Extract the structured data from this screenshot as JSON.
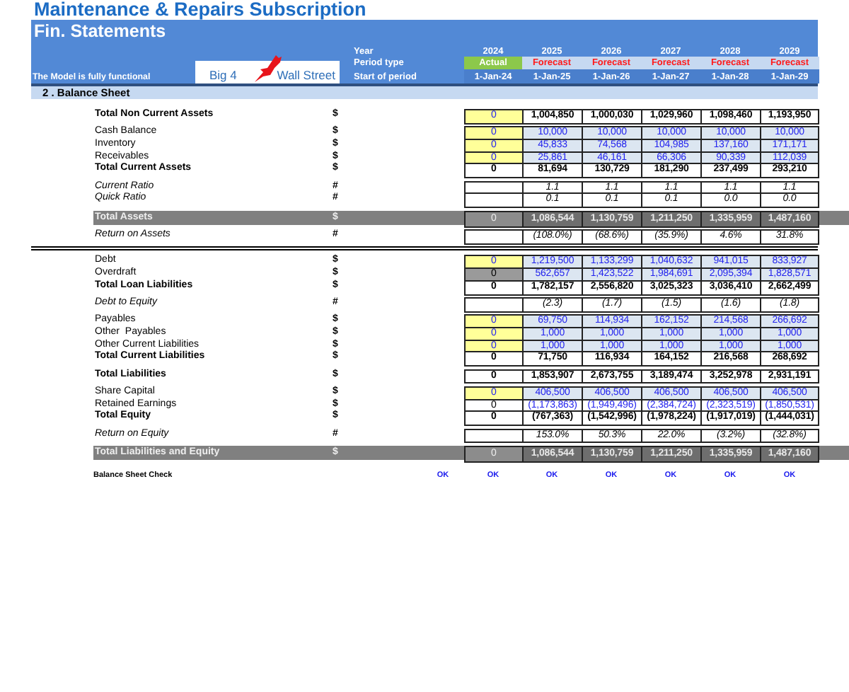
{
  "title": "Maintenance & Repairs Subscription",
  "sheet": "Fin. Statements",
  "model_status": "The Model is fully functional",
  "logo": {
    "left": "Big 4",
    "right": "Wall Street"
  },
  "header_labels": [
    "Year",
    "Period type",
    "Start of period"
  ],
  "periods": [
    {
      "year": "2024",
      "type": "Actual",
      "start": "1-Jan-24",
      "kind": "actual"
    },
    {
      "year": "2025",
      "type": "Forecast",
      "start": "1-Jan-25",
      "kind": "forecast"
    },
    {
      "year": "2026",
      "type": "Forecast",
      "start": "1-Jan-26",
      "kind": "forecast"
    },
    {
      "year": "2027",
      "type": "Forecast",
      "start": "1-Jan-27",
      "kind": "forecast"
    },
    {
      "year": "2028",
      "type": "Forecast",
      "start": "1-Jan-28",
      "kind": "forecast"
    },
    {
      "year": "2029",
      "type": "Forecast",
      "start": "1-Jan-29",
      "kind": "forecast"
    }
  ],
  "section": "2 . Balance Sheet",
  "blocks": [
    {
      "kind": "plain",
      "rows": [
        {
          "label": "Total Non Current Assets",
          "unit": "$",
          "kind": "total",
          "actual": {
            "value": "0",
            "kind": "input"
          },
          "values": [
            "1,004,850",
            "1,000,030",
            "1,029,960",
            "1,098,460",
            "1,193,950"
          ]
        }
      ]
    },
    {
      "kind": "plain",
      "rows": [
        {
          "label": "Cash Balance",
          "unit": "$",
          "kind": "input",
          "actual": {
            "value": "0",
            "kind": "input"
          },
          "values": [
            "10,000",
            "10,000",
            "10,000",
            "10,000",
            "10,000"
          ]
        },
        {
          "label": "Inventory",
          "unit": "$",
          "kind": "input",
          "actual": {
            "value": "0",
            "kind": "input"
          },
          "values": [
            "45,833",
            "74,568",
            "104,985",
            "137,160",
            "171,171"
          ]
        },
        {
          "label": "Receivables",
          "unit": "$",
          "kind": "input",
          "actual": {
            "value": "0",
            "kind": "input"
          },
          "values": [
            "25,861",
            "46,161",
            "66,306",
            "90,339",
            "112,039"
          ]
        },
        {
          "label": "Total Current Assets",
          "unit": "$",
          "kind": "total",
          "actual": {
            "value": "0",
            "kind": "calc"
          },
          "values": [
            "81,694",
            "130,729",
            "181,290",
            "237,499",
            "293,210"
          ]
        }
      ]
    },
    {
      "kind": "plain",
      "rows": [
        {
          "label": "Current Ratio",
          "unit": "#",
          "kind": "ratio",
          "values": [
            "1.1",
            "1.1",
            "1.1",
            "1.1",
            "1.1"
          ]
        },
        {
          "label": "Quick Ratio",
          "unit": "#",
          "kind": "ratio",
          "values": [
            "0.1",
            "0.1",
            "0.1",
            "0.0",
            "0.0"
          ]
        }
      ]
    },
    {
      "kind": "plain",
      "rows": [
        {
          "label": "Total Assets",
          "unit": "$",
          "kind": "band",
          "actual": {
            "value": "0",
            "kind": "band"
          },
          "values": [
            "1,086,544",
            "1,130,759",
            "1,211,250",
            "1,335,959",
            "1,487,160"
          ]
        }
      ]
    },
    {
      "kind": "plain",
      "rows": [
        {
          "label": "Return on Assets",
          "unit": "#",
          "kind": "ratio",
          "values": [
            "(108.0%)",
            "(68.6%)",
            "(35.9%)",
            "4.6%",
            "31.8%"
          ]
        }
      ]
    },
    {
      "kind": "ruled",
      "rows": [
        {
          "label": "Debt",
          "unit": "$",
          "kind": "input",
          "actual": {
            "value": "0",
            "kind": "input"
          },
          "values": [
            "1,219,500",
            "1,133,299",
            "1,040,632",
            "941,015",
            "833,927"
          ]
        },
        {
          "label": "Overdraft",
          "unit": "$",
          "kind": "input",
          "actual": {
            "value": "0",
            "kind": "grey"
          },
          "values": [
            "562,657",
            "1,423,522",
            "1,984,691",
            "2,095,394",
            "1,828,571"
          ]
        },
        {
          "label": "Total Loan Liabilities",
          "unit": "$",
          "kind": "total",
          "actual": {
            "value": "0",
            "kind": "calc"
          },
          "values": [
            "1,782,157",
            "2,556,820",
            "3,025,323",
            "3,036,410",
            "2,662,499"
          ]
        }
      ]
    },
    {
      "kind": "plain",
      "rows": [
        {
          "label": "Debt to Equity",
          "unit": "#",
          "kind": "ratio",
          "values": [
            "(2.3)",
            "(1.7)",
            "(1.5)",
            "(1.6)",
            "(1.8)"
          ]
        }
      ]
    },
    {
      "kind": "plain",
      "rows": [
        {
          "label": "Payables",
          "unit": "$",
          "kind": "input",
          "actual": {
            "value": "0",
            "kind": "input"
          },
          "values": [
            "69,750",
            "114,934",
            "162,152",
            "214,568",
            "266,692"
          ]
        },
        {
          "label": "Other  Payables",
          "unit": "$",
          "kind": "input",
          "actual": {
            "value": "0",
            "kind": "input"
          },
          "values": [
            "1,000",
            "1,000",
            "1,000",
            "1,000",
            "1,000"
          ]
        },
        {
          "label": "Other Current Liabilities",
          "unit": "$",
          "kind": "input",
          "actual": {
            "value": "0",
            "kind": "input"
          },
          "values": [
            "1,000",
            "1,000",
            "1,000",
            "1,000",
            "1,000"
          ]
        },
        {
          "label": "Total Current Liabilities",
          "unit": "$",
          "kind": "total",
          "actual": {
            "value": "0",
            "kind": "calc"
          },
          "values": [
            "71,750",
            "116,934",
            "164,152",
            "216,568",
            "268,692"
          ]
        }
      ]
    },
    {
      "kind": "plain",
      "rows": [
        {
          "label": "Total Liabilities",
          "unit": "$",
          "kind": "total",
          "actual": {
            "value": "0",
            "kind": "calc"
          },
          "values": [
            "1,853,907",
            "2,673,755",
            "3,189,474",
            "3,252,978",
            "2,931,191"
          ]
        }
      ]
    },
    {
      "kind": "plain",
      "rows": [
        {
          "label": "Share Capital",
          "unit": "$",
          "kind": "input",
          "actual": {
            "value": "0",
            "kind": "input"
          },
          "values": [
            "406,500",
            "406,500",
            "406,500",
            "406,500",
            "406,500"
          ]
        },
        {
          "label": "Retained Earnings",
          "unit": "$",
          "kind": "linked",
          "actual": {
            "value": "0",
            "kind": "calc"
          },
          "values": [
            "(1,173,863)",
            "(1,949,496)",
            "(2,384,724)",
            "(2,323,519)",
            "(1,850,531)"
          ]
        },
        {
          "label": "Total Equity",
          "unit": "$",
          "kind": "total",
          "actual": {
            "value": "0",
            "kind": "calc"
          },
          "values": [
            "(767,363)",
            "(1,542,996)",
            "(1,978,224)",
            "(1,917,019)",
            "(1,444,031)"
          ]
        }
      ]
    },
    {
      "kind": "plain",
      "rows": [
        {
          "label": "Return on Equity",
          "unit": "#",
          "kind": "ratio",
          "values": [
            "153.0%",
            "50.3%",
            "22.0%",
            "(3.2%)",
            "(32.8%)"
          ]
        }
      ]
    },
    {
      "kind": "plain",
      "rows": [
        {
          "label": "Total Liabilities and Equity",
          "unit": "$",
          "kind": "band",
          "actual": {
            "value": "0",
            "kind": "band"
          },
          "values": [
            "1,086,544",
            "1,130,759",
            "1,211,250",
            "1,335,959",
            "1,487,160"
          ]
        }
      ]
    }
  ],
  "check": {
    "label": "Balance Sheet Check",
    "results": [
      "OK",
      "OK",
      "OK",
      "OK",
      "OK",
      "OK",
      "OK"
    ]
  }
}
